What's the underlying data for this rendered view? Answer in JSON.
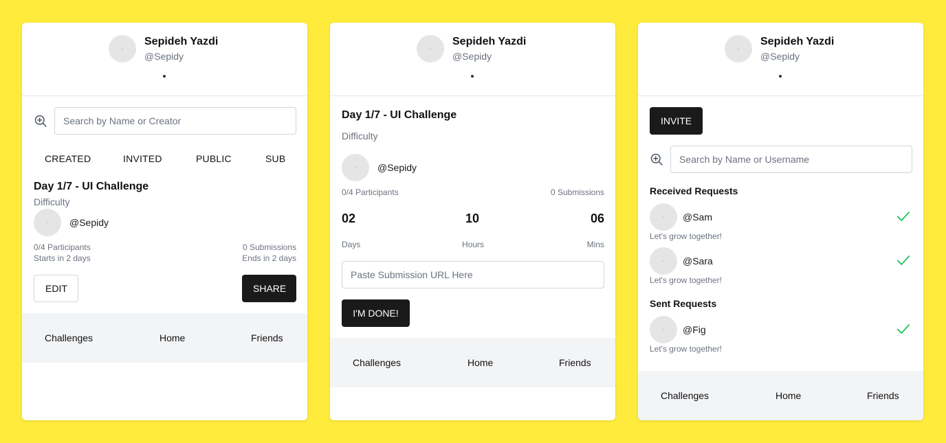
{
  "profile": {
    "name": "Sepideh Yazdi",
    "handle": "@Sepidy"
  },
  "challenges_screen": {
    "search": {
      "placeholder": "Search by Name or Creator",
      "icon": "zoom-in-icon"
    },
    "tabs": [
      "CREATED",
      "INVITED",
      "PUBLIC",
      "SUB"
    ],
    "challenge": {
      "title": "Day 1/7 - UI Challenge",
      "difficulty": "Difficulty",
      "creator": "@Sepidy",
      "participants": "0/4 Participants",
      "submissions": "0 Submissions",
      "starts": "Starts in 2 days",
      "ends": "Ends in 2 days"
    },
    "edit_label": "EDIT",
    "share_label": "SHARE"
  },
  "detail_screen": {
    "title": "Day 1/7 - UI Challenge",
    "difficulty": "Difficulty",
    "creator": "@Sepidy",
    "participants": "0/4 Participants",
    "submissions": "0 Submissions",
    "countdown": [
      {
        "value": "02",
        "label": "Days"
      },
      {
        "value": "10",
        "label": "Hours"
      },
      {
        "value": "06",
        "label": "Mins"
      }
    ],
    "url_placeholder": "Paste Submission URL Here",
    "done_label": "I'M DONE!"
  },
  "friends_screen": {
    "invite_label": "INVITE",
    "search": {
      "placeholder": "Search by Name or Username",
      "icon": "zoom-in-icon"
    },
    "received_title": "Received Requests",
    "received": [
      {
        "handle": "@Sam",
        "message": "Let's grow together!"
      },
      {
        "handle": "@Sara",
        "message": "Let's grow together!"
      }
    ],
    "sent_title": "Sent Requests",
    "sent": [
      {
        "handle": "@Fig",
        "message": "Let's grow together!"
      }
    ],
    "accept_icon": "check-icon",
    "accept_color": "#22c55e"
  },
  "nav": {
    "challenges": "Challenges",
    "home": "Home",
    "friends": "Friends"
  },
  "colors": {
    "background": "#ffeb3b",
    "dark_button": "#1a1a1a",
    "nav_bg": "#f3f4f6"
  }
}
